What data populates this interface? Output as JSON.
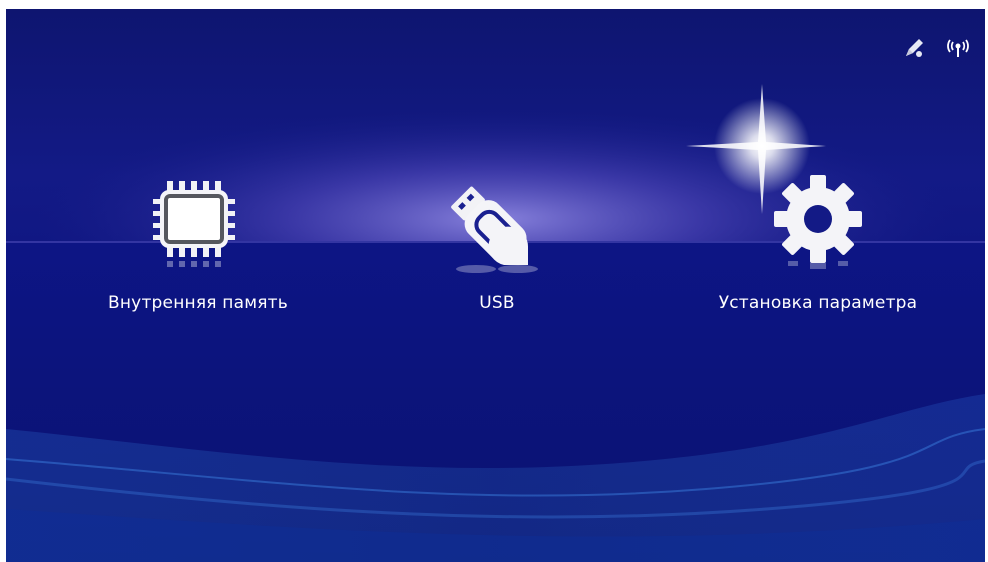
{
  "status_bar": {
    "icons": [
      "pencil-icon",
      "wireless-signal-icon"
    ]
  },
  "menu": {
    "items": [
      {
        "label": "Внутренняя память",
        "icon": "memory-chip-icon"
      },
      {
        "label": "USB",
        "icon": "usb-drive-icon"
      },
      {
        "label": "Установка параметра",
        "icon": "settings-gear-icon"
      }
    ]
  },
  "colors": {
    "background": "#0e1570",
    "horizon_glow": "#6a62c8",
    "text": "#ffffff"
  }
}
